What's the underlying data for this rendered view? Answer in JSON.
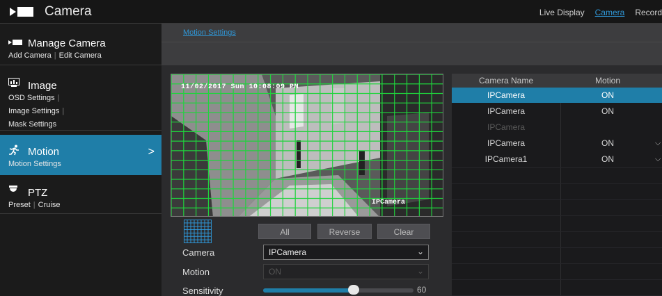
{
  "app": {
    "title": "Camera"
  },
  "topnav": {
    "items": [
      "Live Display",
      "Camera",
      "Record"
    ],
    "active": "Camera"
  },
  "sidebar": {
    "manage": {
      "title": "Manage Camera",
      "links": [
        "Add Camera",
        "Edit Camera"
      ]
    },
    "image": {
      "title": "Image",
      "links": [
        "OSD Settings",
        "Image Settings",
        "Mask Settings"
      ]
    },
    "motion": {
      "title": "Motion",
      "links": [
        "Motion Settings"
      ],
      "arrow": ">"
    },
    "ptz": {
      "title": "PTZ",
      "links": [
        "Preset",
        "Cruise"
      ]
    }
  },
  "breadcrumb": "Motion Settings",
  "preview": {
    "timestamp": "11/02/2017 Sun 10:08:09 PM",
    "camera_label": "IPCamera"
  },
  "buttons": {
    "all": "All",
    "reverse": "Reverse",
    "clear": "Clear"
  },
  "form": {
    "camera_label": "Camera",
    "camera_value": "IPCamera",
    "motion_label": "Motion",
    "motion_value": "ON",
    "sensitivity_label": "Sensitivity",
    "sensitivity_value": "60"
  },
  "table": {
    "headers": [
      "Camera Name",
      "Motion"
    ],
    "rows": [
      {
        "name": "IPCamera",
        "motion": "ON",
        "state": "selected"
      },
      {
        "name": "IPCamera",
        "motion": "ON",
        "state": "normal"
      },
      {
        "name": "IPCamera",
        "motion": "",
        "state": "disabled"
      },
      {
        "name": "IPCamera",
        "motion": "ON",
        "state": "normal"
      },
      {
        "name": "IPCamera1",
        "motion": "ON",
        "state": "normal"
      }
    ]
  },
  "colors": {
    "accent": "#1f7ea8",
    "link": "#2f96d6",
    "grid": "#1fd43c"
  }
}
